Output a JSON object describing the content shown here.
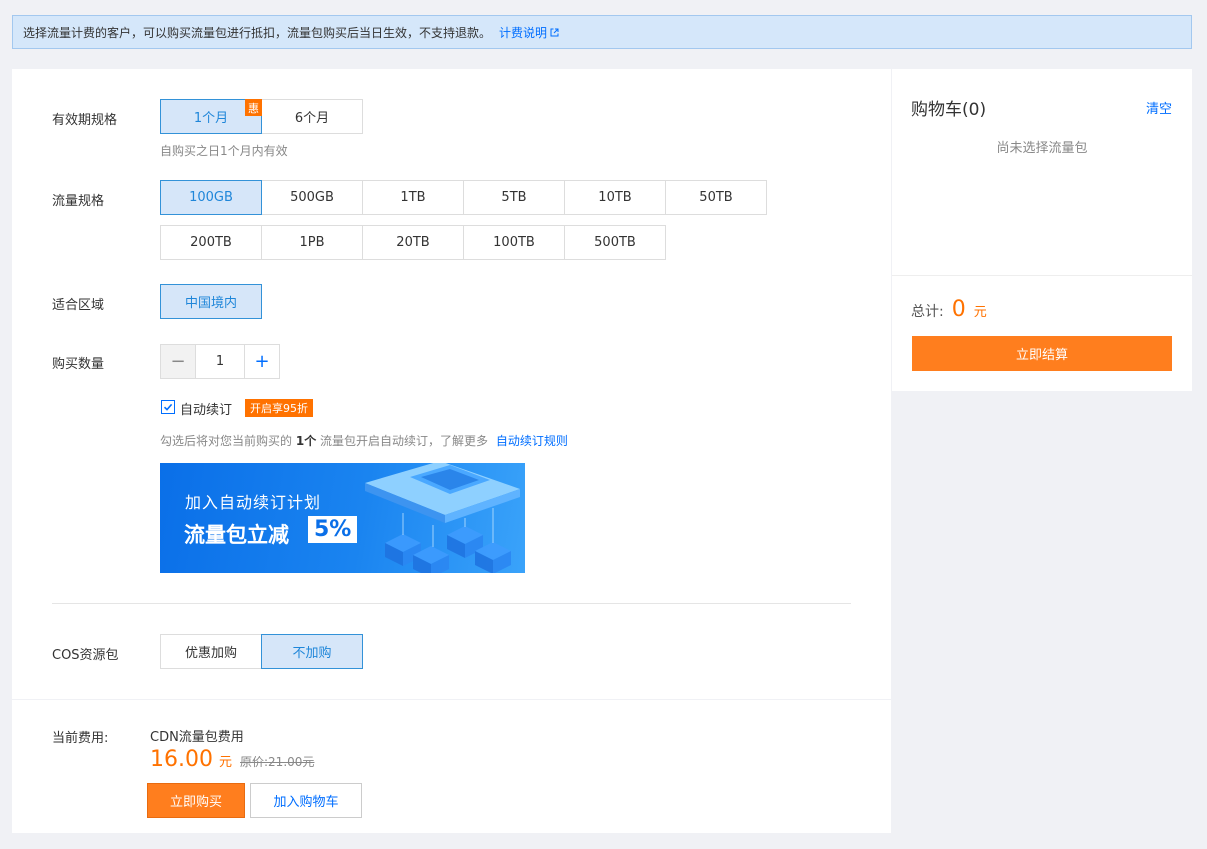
{
  "notice": {
    "text": "选择流量计费的客户，可以购买流量包进行抵扣，流量包购买后当日生效，不支持退款。",
    "link": "计费说明"
  },
  "validity": {
    "label": "有效期规格",
    "options": [
      "1个月",
      "6个月"
    ],
    "selected": "1个月",
    "badge": "惠",
    "hint": "自购买之日1个月内有效"
  },
  "traffic": {
    "label": "流量规格",
    "row1": [
      "100GB",
      "500GB",
      "1TB",
      "5TB",
      "10TB",
      "50TB"
    ],
    "row2": [
      "200TB",
      "1PB",
      "20TB",
      "100TB",
      "500TB"
    ],
    "selected": "100GB"
  },
  "region": {
    "label": "适合区域",
    "options": [
      "中国境内"
    ],
    "selected": "中国境内"
  },
  "quantity": {
    "label": "购买数量",
    "value": "1",
    "minus": "−",
    "plus": "+"
  },
  "auto_renew": {
    "checked": true,
    "label": "自动续订",
    "tag": "开启享95折",
    "hint_pre": "勾选后将对您当前购买的",
    "hint_count": "1个",
    "hint_post": "流量包开启自动续订，了解更多",
    "hint_link": "自动续订规则"
  },
  "banner": {
    "line1": "加入自动续订计划",
    "line2": "流量包立减",
    "percent": "5%"
  },
  "cos": {
    "label": "COS资源包",
    "options": [
      "优惠加购",
      "不加购"
    ],
    "selected": "不加购"
  },
  "footer": {
    "label": "当前费用:",
    "title": "CDN流量包费用",
    "price": "16.00",
    "unit": "元",
    "original": "原价:21.00元",
    "buy_label": "立即购买",
    "cart_label": "加入购物车"
  },
  "cart": {
    "title": "购物车(0)",
    "clear": "清空",
    "empty": "尚未选择流量包",
    "total_label": "总计:",
    "total": "0",
    "unit": "元",
    "checkout": "立即结算"
  },
  "colors": {
    "accent": "#006eff",
    "orange": "#ff7200",
    "selected_bg": "#d6e6f9",
    "selected_border": "#3392d8"
  }
}
